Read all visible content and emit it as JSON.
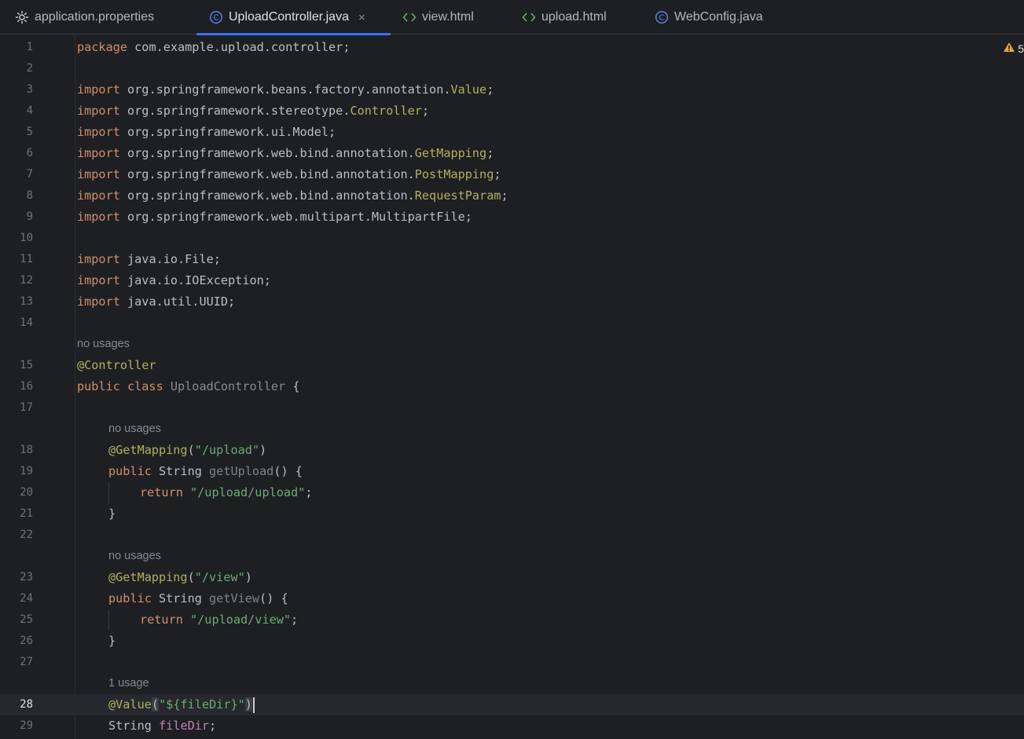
{
  "tabs": [
    {
      "label": "application.properties",
      "icon": "gear-icon",
      "active": false
    },
    {
      "label": "UploadController.java",
      "icon": "class-icon",
      "active": true
    },
    {
      "label": "view.html",
      "icon": "html-icon",
      "active": false
    },
    {
      "label": "upload.html",
      "icon": "html-icon",
      "active": false
    },
    {
      "label": "WebConfig.java",
      "icon": "class-icon",
      "active": false
    }
  ],
  "close_glyph": "×",
  "inspection": {
    "icon": "warning-icon",
    "count": "5"
  },
  "colors": {
    "background": "#1e1f22",
    "keyword": "#cf8e6d",
    "annotation": "#b3ae60",
    "string": "#6aab73",
    "field": "#c77dbb",
    "accent": "#3574f0",
    "warning": "#e8a33c"
  },
  "hints": {
    "class_usages": "no usages",
    "get_upload_usages": "no usages",
    "get_view_usages": "no usages",
    "value_usages": "1 usage"
  },
  "lines": {
    "l1": {
      "num": "1",
      "k": "package",
      "t": " com.example.upload.controller;"
    },
    "l2": {
      "num": "2"
    },
    "l3": {
      "num": "3",
      "k": "import",
      "t": " org.springframework.beans.factory.annotation.",
      "a": "Value",
      "e": ";"
    },
    "l4": {
      "num": "4",
      "k": "import",
      "t": " org.springframework.stereotype.",
      "a": "Controller",
      "e": ";"
    },
    "l5": {
      "num": "5",
      "k": "import",
      "t": " org.springframework.ui.Model;"
    },
    "l6": {
      "num": "6",
      "k": "import",
      "t": " org.springframework.web.bind.annotation.",
      "a": "GetMapping",
      "e": ";"
    },
    "l7": {
      "num": "7",
      "k": "import",
      "t": " org.springframework.web.bind.annotation.",
      "a": "PostMapping",
      "e": ";"
    },
    "l8": {
      "num": "8",
      "k": "import",
      "t": " org.springframework.web.bind.annotation.",
      "a": "RequestParam",
      "e": ";"
    },
    "l9": {
      "num": "9",
      "k": "import",
      "t": " org.springframework.web.multipart.MultipartFile;"
    },
    "l10": {
      "num": "10"
    },
    "l11": {
      "num": "11",
      "k": "import",
      "t": " java.io.File;"
    },
    "l12": {
      "num": "12",
      "k": "import",
      "t": " java.io.IOException;"
    },
    "l13": {
      "num": "13",
      "k": "import",
      "t": " java.util.UUID;"
    },
    "l14": {
      "num": "14"
    },
    "l15": {
      "num": "15",
      "a": "@Controller"
    },
    "l16": {
      "num": "16",
      "k": "public class",
      "n": " UploadController",
      "e": " {"
    },
    "l17": {
      "num": "17"
    },
    "l18": {
      "num": "18",
      "a": "@GetMapping",
      "p1": "(",
      "s": "\"/upload\"",
      "p2": ")"
    },
    "l19": {
      "num": "19",
      "k": "public",
      "t": " String ",
      "n": "getUpload",
      "e": "() {"
    },
    "l20": {
      "num": "20",
      "k": "return",
      "s": " \"/upload/upload\"",
      "e": ";"
    },
    "l21": {
      "num": "21",
      "t": "}"
    },
    "l22": {
      "num": "22"
    },
    "l23": {
      "num": "23",
      "a": "@GetMapping",
      "p1": "(",
      "s": "\"/view\"",
      "p2": ")"
    },
    "l24": {
      "num": "24",
      "k": "public",
      "t": " String ",
      "n": "getView",
      "e": "() {"
    },
    "l25": {
      "num": "25",
      "k": "return",
      "s": " \"/upload/view\"",
      "e": ";"
    },
    "l26": {
      "num": "26",
      "t": "}"
    },
    "l27": {
      "num": "27"
    },
    "l28": {
      "num": "28",
      "a": "@Value",
      "p1": "(",
      "s": "\"${fileDir}\"",
      "p2": ")"
    },
    "l29": {
      "num": "29",
      "t": "String ",
      "f": "fileDir",
      "e": ";"
    }
  }
}
